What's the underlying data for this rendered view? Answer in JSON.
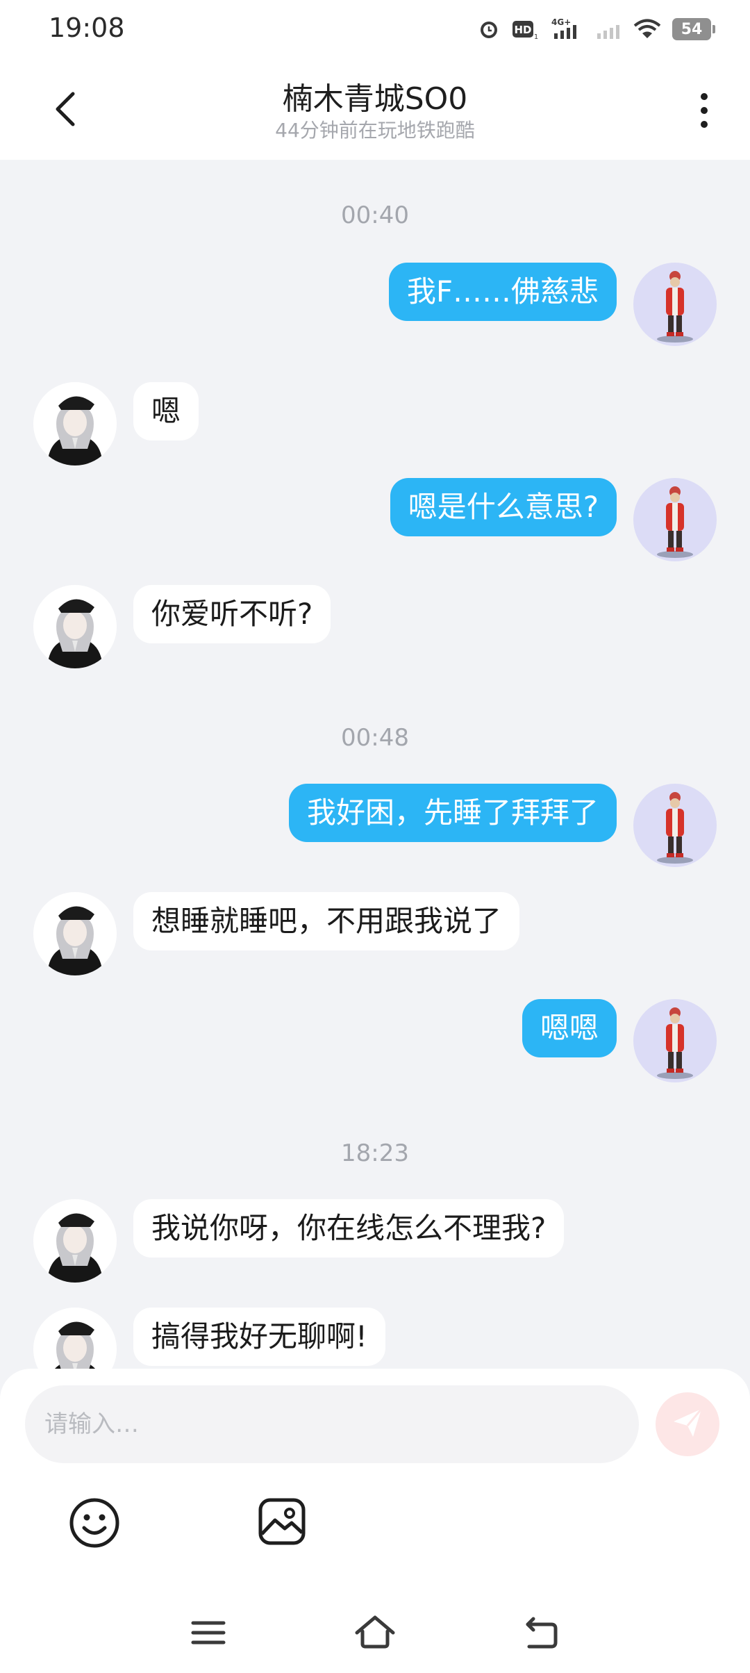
{
  "status_bar": {
    "time": "19:08",
    "battery": "54"
  },
  "header": {
    "title": "楠木青城SO0",
    "subtitle": "44分钟前在玩地铁跑酷"
  },
  "chat": {
    "time_labels": [
      "00:40",
      "00:48",
      "18:23"
    ],
    "messages": [
      {
        "side": "out",
        "text": "我F……佛慈悲"
      },
      {
        "side": "in",
        "text": "嗯"
      },
      {
        "side": "out",
        "text": "嗯是什么意思?"
      },
      {
        "side": "in",
        "text": "你爱听不听?"
      },
      {
        "side": "out",
        "text": "我好困，先睡了拜拜了"
      },
      {
        "side": "in",
        "text": "想睡就睡吧，不用跟我说了"
      },
      {
        "side": "out",
        "text": "嗯嗯"
      },
      {
        "side": "in",
        "text": "我说你呀，你在线怎么不理我?"
      },
      {
        "side": "in",
        "text": "搞得我好无聊啊!"
      }
    ]
  },
  "input": {
    "placeholder": "请输入…",
    "value": ""
  },
  "icons": {
    "back": "chevron-left-icon",
    "more": "more-vertical-icon",
    "send": "send-icon",
    "emoji": "smiley-icon",
    "image": "image-icon",
    "nav_menu": "menu-icon",
    "nav_home": "home-icon",
    "nav_back": "back-return-icon"
  },
  "colors": {
    "outgoing_bubble": "#2cb5f5",
    "incoming_bubble": "#ffffff",
    "chat_background": "#f2f3f6",
    "send_button": "#fde6e6"
  }
}
